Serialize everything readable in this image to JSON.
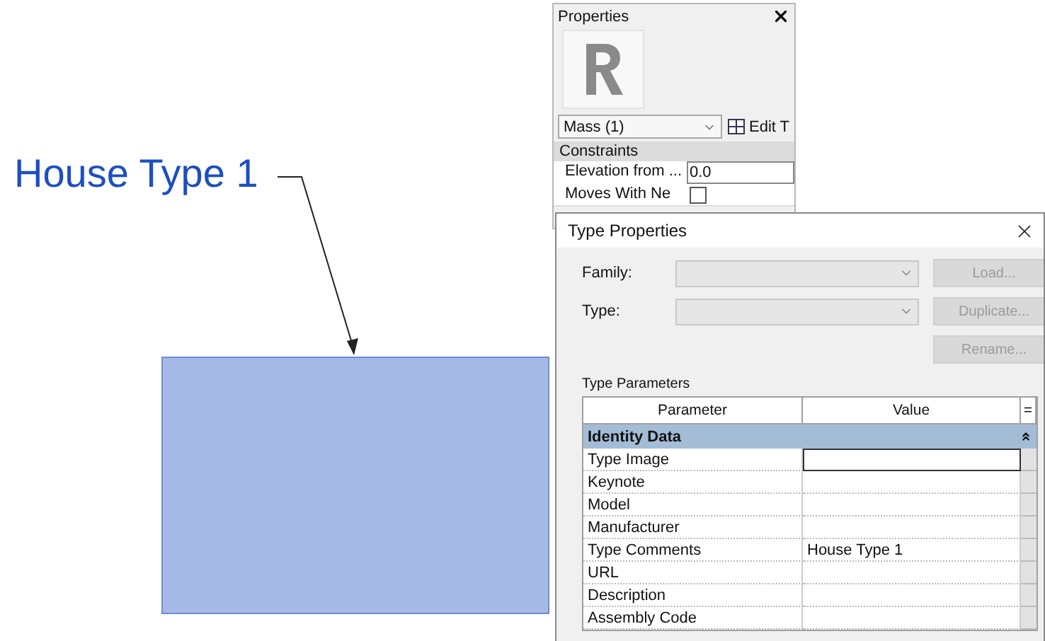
{
  "canvas": {
    "tag": {
      "text": "House Type 1"
    },
    "mass": {
      "kind": "rectangle"
    }
  },
  "properties": {
    "title": "Properties",
    "type_selector": "Mass (1)",
    "edit_type": "Edit T",
    "group": "Constraints",
    "rows": [
      {
        "kind": "text",
        "label": "Elevation from ...",
        "value": "0.0"
      },
      {
        "kind": "checkbox",
        "label": "Moves With Ne",
        "checked": false
      }
    ]
  },
  "type_properties": {
    "title": "Type Properties",
    "fields": [
      {
        "label": "Family:",
        "disabled": true
      },
      {
        "label": "Type:",
        "disabled": true
      }
    ],
    "buttons": [
      {
        "label": "Load...",
        "disabled": true
      },
      {
        "label": "Duplicate...",
        "disabled": true
      },
      {
        "label": "Rename...",
        "disabled": true
      }
    ],
    "section_title": "Type Parameters",
    "columns": [
      "Parameter",
      "Value",
      "="
    ],
    "group": {
      "name": "Identity Data",
      "expanded": true
    },
    "rows": [
      {
        "parameter": "Type Image",
        "selected": true
      },
      {
        "parameter": "Keynote",
        "selected": false
      },
      {
        "parameter": "Model",
        "selected": false
      },
      {
        "parameter": "Manufacturer",
        "selected": false
      },
      {
        "parameter": "Type Comments",
        "value": "House Type 1",
        "selected": false
      },
      {
        "parameter": "URL",
        "selected": false
      },
      {
        "parameter": "Description",
        "selected": false
      },
      {
        "parameter": "Assembly Code",
        "selected": false
      }
    ]
  }
}
